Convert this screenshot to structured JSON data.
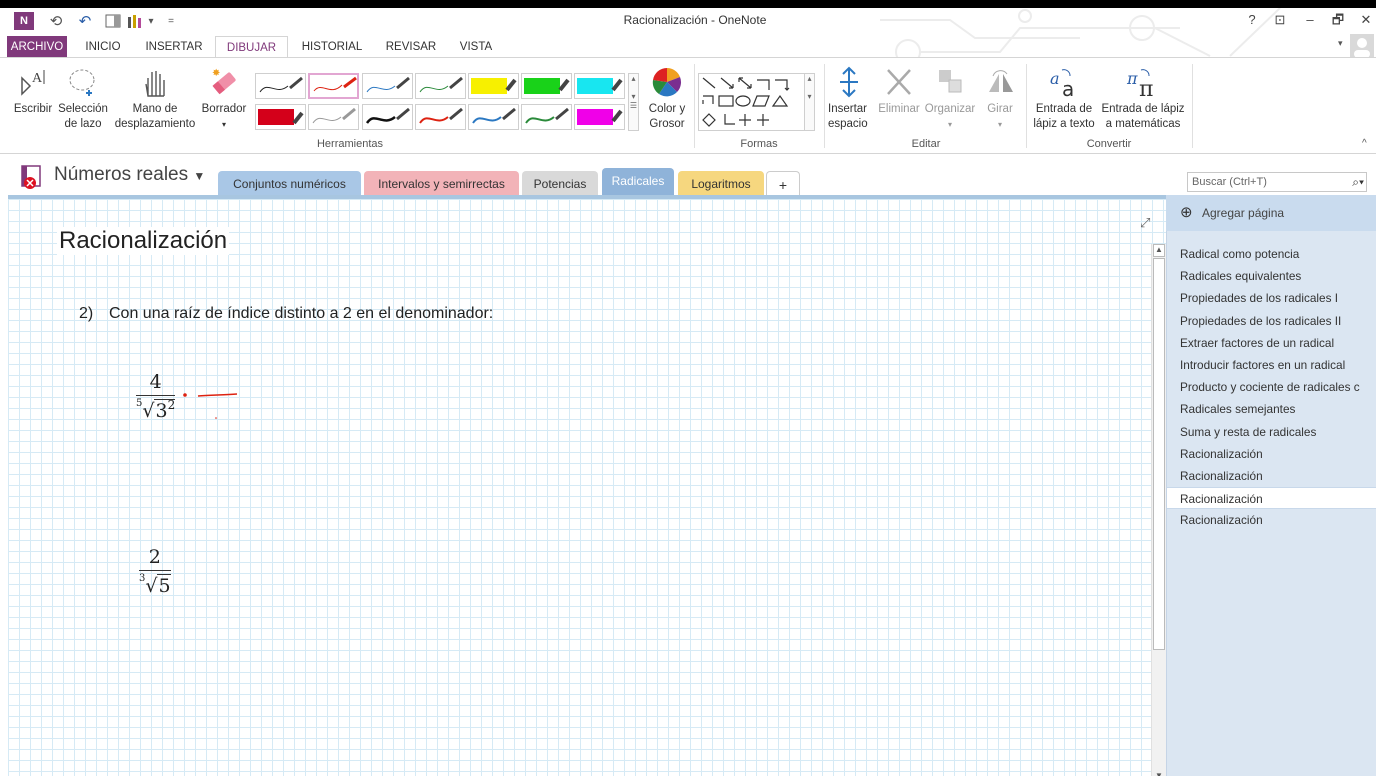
{
  "window": {
    "title": "Racionalización - OneNote",
    "help": "?",
    "ribbon_display": "⊡",
    "minimize": "–",
    "restore": "🗗",
    "close": "✕"
  },
  "quick_access": {
    "app_icon": "N",
    "back": "⟲",
    "undo": "↶",
    "customize": "▾",
    "more": "="
  },
  "ribbon_tabs": [
    "ARCHIVO",
    "INICIO",
    "INSERTAR",
    "DIBUJAR",
    "HISTORIAL",
    "REVISAR",
    "VISTA"
  ],
  "ribbon": {
    "escribir": "Escribir",
    "seleccion": [
      "Selección",
      "de lazo"
    ],
    "mano": [
      "Mano de",
      "desplazamiento"
    ],
    "borrador": "Borrador",
    "color_grosor": [
      "Color y",
      "Grosor"
    ],
    "insertar_espacio": [
      "Insertar",
      "espacio"
    ],
    "eliminar": "Eliminar",
    "organizar": "Organizar",
    "girar": "Girar",
    "entrada_texto": [
      "Entrada de",
      "lápiz a texto"
    ],
    "entrada_mate": [
      "Entrada de lápiz",
      "a matemáticas"
    ],
    "groups": {
      "herramientas": "Herramientas",
      "formas": "Formas",
      "editar": "Editar",
      "convertir": "Convertir"
    }
  },
  "notebook": {
    "name": "Números reales",
    "sections": [
      "Conjuntos numéricos",
      "Intervalos y semirrectas",
      "Potencias",
      "Radicales",
      "Logaritmos",
      "+"
    ]
  },
  "search": {
    "placeholder": "Buscar (Ctrl+T)"
  },
  "page": {
    "title": "Racionalización",
    "item_number": "2)",
    "item_text": "Con una raíz de índice distinto a 2 en el denominador:",
    "fraction1": {
      "numerator": "4",
      "index": "5",
      "radicand": "3",
      "exponent": "2"
    },
    "fraction2": {
      "numerator": "2",
      "index": "3",
      "radicand": "5"
    }
  },
  "pages_pane": {
    "add_page": "Agregar página",
    "pages": [
      "Radical como potencia",
      "Radicales equivalentes",
      "Propiedades de los radicales I",
      "Propiedades de los radicales II",
      "Extraer factores de un radical",
      "Introducir factores en un radical",
      "Producto y cociente de radicales c",
      "Radicales semejantes",
      "Suma y resta de radicales",
      "Racionalización",
      "Racionalización",
      "Racionalización",
      "Racionalización"
    ],
    "active_index": 11
  },
  "colors": {
    "archivo_tab": "#80397b",
    "tab_conjuntos": "#a9c7e6",
    "tab_intervalos": "#f2b3b8",
    "tab_potencias": "#d9d9d9",
    "tab_radicales": "#8fb3d9",
    "tab_logaritmos": "#f6d77f"
  }
}
